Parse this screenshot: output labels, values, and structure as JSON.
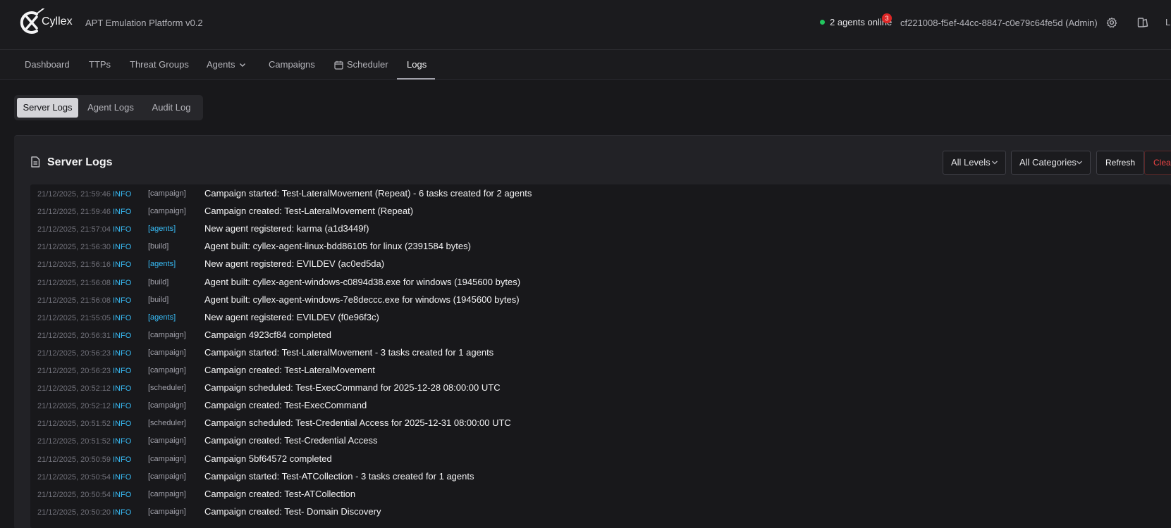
{
  "header": {
    "brand": "Cyllex",
    "subtitle": "APT Emulation Platform v0.2",
    "agents_online": "2 agents online",
    "notification_count": "3",
    "user": "cf221008-f5ef-44cc-8847-c0e79c64fe5d (Admin)",
    "truncated_label": "L",
    "icons": [
      "settings-icon",
      "theme-toggle-icon"
    ]
  },
  "nav": {
    "items": [
      {
        "label": "Dashboard"
      },
      {
        "label": "TTPs"
      },
      {
        "label": "Threat Groups"
      },
      {
        "label": "Agents"
      },
      {
        "label": "Campaigns"
      },
      {
        "label": "Scheduler"
      },
      {
        "label": "Logs"
      }
    ],
    "active": "Logs"
  },
  "tabs": {
    "items": [
      "Server Logs",
      "Agent Logs",
      "Audit Log"
    ],
    "active": "Server Logs"
  },
  "panel": {
    "title": "Server Logs",
    "level_filter": "All Levels",
    "category_filter": "All Categories",
    "refresh_label": "Refresh",
    "clear_label": "Clear"
  },
  "colors": {
    "accent_info": "#38bdf8",
    "online": "#22c55e",
    "badge": "#dc2626",
    "danger": "#ef4444"
  },
  "logs": [
    {
      "ts": "21/12/2025, 21:59:46",
      "level": "INFO",
      "category": "[campaign]",
      "msg": "Campaign started: Test-LateralMovement (Repeat) - 6 tasks created for 2 agents"
    },
    {
      "ts": "21/12/2025, 21:59:46",
      "level": "INFO",
      "category": "[campaign]",
      "msg": "Campaign created: Test-LateralMovement (Repeat)"
    },
    {
      "ts": "21/12/2025, 21:57:04",
      "level": "INFO",
      "category": "[agents]",
      "msg": "New agent registered: karma (a1d3449f)"
    },
    {
      "ts": "21/12/2025, 21:56:30",
      "level": "INFO",
      "category": "[build]",
      "msg": "Agent built: cyllex-agent-linux-bdd86105 for linux (2391584 bytes)"
    },
    {
      "ts": "21/12/2025, 21:56:16",
      "level": "INFO",
      "category": "[agents]",
      "msg": "New agent registered: EVILDEV (ac0ed5da)"
    },
    {
      "ts": "21/12/2025, 21:56:08",
      "level": "INFO",
      "category": "[build]",
      "msg": "Agent built: cyllex-agent-windows-c0894d38.exe for windows (1945600 bytes)"
    },
    {
      "ts": "21/12/2025, 21:56:08",
      "level": "INFO",
      "category": "[build]",
      "msg": "Agent built: cyllex-agent-windows-7e8deccc.exe for windows (1945600 bytes)"
    },
    {
      "ts": "21/12/2025, 21:55:05",
      "level": "INFO",
      "category": "[agents]",
      "msg": "New agent registered: EVILDEV (f0e96f3c)"
    },
    {
      "ts": "21/12/2025, 20:56:31",
      "level": "INFO",
      "category": "[campaign]",
      "msg": "Campaign 4923cf84 completed"
    },
    {
      "ts": "21/12/2025, 20:56:23",
      "level": "INFO",
      "category": "[campaign]",
      "msg": "Campaign started: Test-LateralMovement - 3 tasks created for 1 agents"
    },
    {
      "ts": "21/12/2025, 20:56:23",
      "level": "INFO",
      "category": "[campaign]",
      "msg": "Campaign created: Test-LateralMovement"
    },
    {
      "ts": "21/12/2025, 20:52:12",
      "level": "INFO",
      "category": "[scheduler]",
      "msg": "Campaign scheduled: Test-ExecCommand for 2025-12-28 08:00:00 UTC"
    },
    {
      "ts": "21/12/2025, 20:52:12",
      "level": "INFO",
      "category": "[campaign]",
      "msg": "Campaign created: Test-ExecCommand"
    },
    {
      "ts": "21/12/2025, 20:51:52",
      "level": "INFO",
      "category": "[scheduler]",
      "msg": "Campaign scheduled: Test-Credential Access for 2025-12-31 08:00:00 UTC"
    },
    {
      "ts": "21/12/2025, 20:51:52",
      "level": "INFO",
      "category": "[campaign]",
      "msg": "Campaign created: Test-Credential Access"
    },
    {
      "ts": "21/12/2025, 20:50:59",
      "level": "INFO",
      "category": "[campaign]",
      "msg": "Campaign 5bf64572 completed"
    },
    {
      "ts": "21/12/2025, 20:50:54",
      "level": "INFO",
      "category": "[campaign]",
      "msg": "Campaign started: Test-ATCollection - 3 tasks created for 1 agents"
    },
    {
      "ts": "21/12/2025, 20:50:54",
      "level": "INFO",
      "category": "[campaign]",
      "msg": "Campaign created: Test-ATCollection"
    },
    {
      "ts": "21/12/2025, 20:50:20",
      "level": "INFO",
      "category": "[campaign]",
      "msg": "Campaign created: Test- Domain Discovery"
    }
  ]
}
